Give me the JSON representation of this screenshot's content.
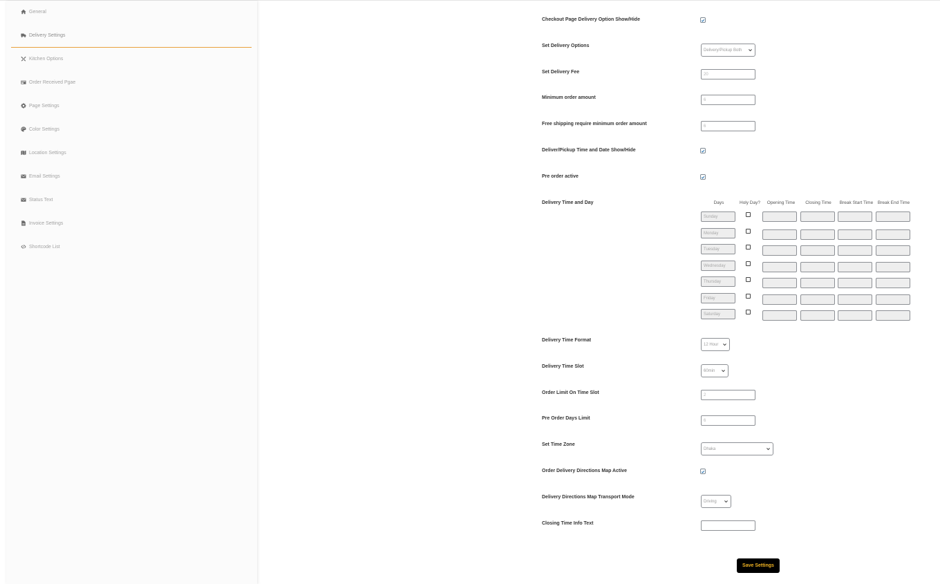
{
  "sidebar": {
    "items": [
      {
        "label": "General",
        "icon": "home-icon"
      },
      {
        "label": "Delivery Settings",
        "icon": "truck-icon"
      },
      {
        "label": "Kitchen Options",
        "icon": "utensils-icon"
      },
      {
        "label": "Order Received Pgae",
        "icon": "receipt-icon"
      },
      {
        "label": "Page Settings",
        "icon": "gear-icon"
      },
      {
        "label": "Color Settings",
        "icon": "palette-icon"
      },
      {
        "label": "Location Settings",
        "icon": "map-icon"
      },
      {
        "label": "Email Settings",
        "icon": "envelope-icon"
      },
      {
        "label": "Status Text",
        "icon": "envelope-icon"
      },
      {
        "label": "Invoice Settings",
        "icon": "file-icon"
      },
      {
        "label": "Shortcode List",
        "icon": "code-icon"
      }
    ],
    "active_index": 1,
    "accent_color": "#e8a13b"
  },
  "form": {
    "checkout_delivery": {
      "label": "Checkout Page Delivery Option Show/Hide",
      "checked": true
    },
    "delivery_options": {
      "label": "Set Delivery Options",
      "value": "Delivery/Pickup Both"
    },
    "delivery_fee": {
      "label": "Set Delivery Fee",
      "value": "20"
    },
    "min_order": {
      "label": "Minimum order amount",
      "value": "6"
    },
    "free_shipping": {
      "label": "Free shipping require minimum order amount",
      "value": "6"
    },
    "time_date_show": {
      "label": "Deliver/Pickup Time and Date Show/Hide",
      "checked": true
    },
    "pre_order": {
      "label": "Pre order active",
      "checked": true
    },
    "time_and_day": {
      "label": "Delivery Time and Day",
      "headers": {
        "days": "Days",
        "holy": "Holy Day?",
        "opening": "Opening Time",
        "closing": "Closing Time",
        "break_start": "Break Start Time",
        "break_end": "Break End Time"
      },
      "days": [
        "Sunday",
        "Monday",
        "Tuesday",
        "Wednesday",
        "Thursday",
        "Friday",
        "Saturday"
      ]
    },
    "time_format": {
      "label": "Delivery Time Format",
      "value": "12 Hour"
    },
    "time_slot": {
      "label": "Delivery Time Slot",
      "value": "60min"
    },
    "order_limit": {
      "label": "Order Limit On Time Slot",
      "value": "2"
    },
    "pre_order_days": {
      "label": "Pre Order Days Limit",
      "value": "6"
    },
    "time_zone": {
      "label": "Set Time Zone",
      "value": "Dhaka"
    },
    "map_active": {
      "label": "Order Delivery Directions Map Active",
      "checked": true
    },
    "transport_mode": {
      "label": "Delivery Directions Map Transport Mode",
      "value": "Driving"
    },
    "closing_info": {
      "label": "Closing Time Info Text",
      "value": ""
    }
  },
  "save_button": {
    "label": "Save Settings",
    "bg": "#000000",
    "color": "#f0b323"
  }
}
